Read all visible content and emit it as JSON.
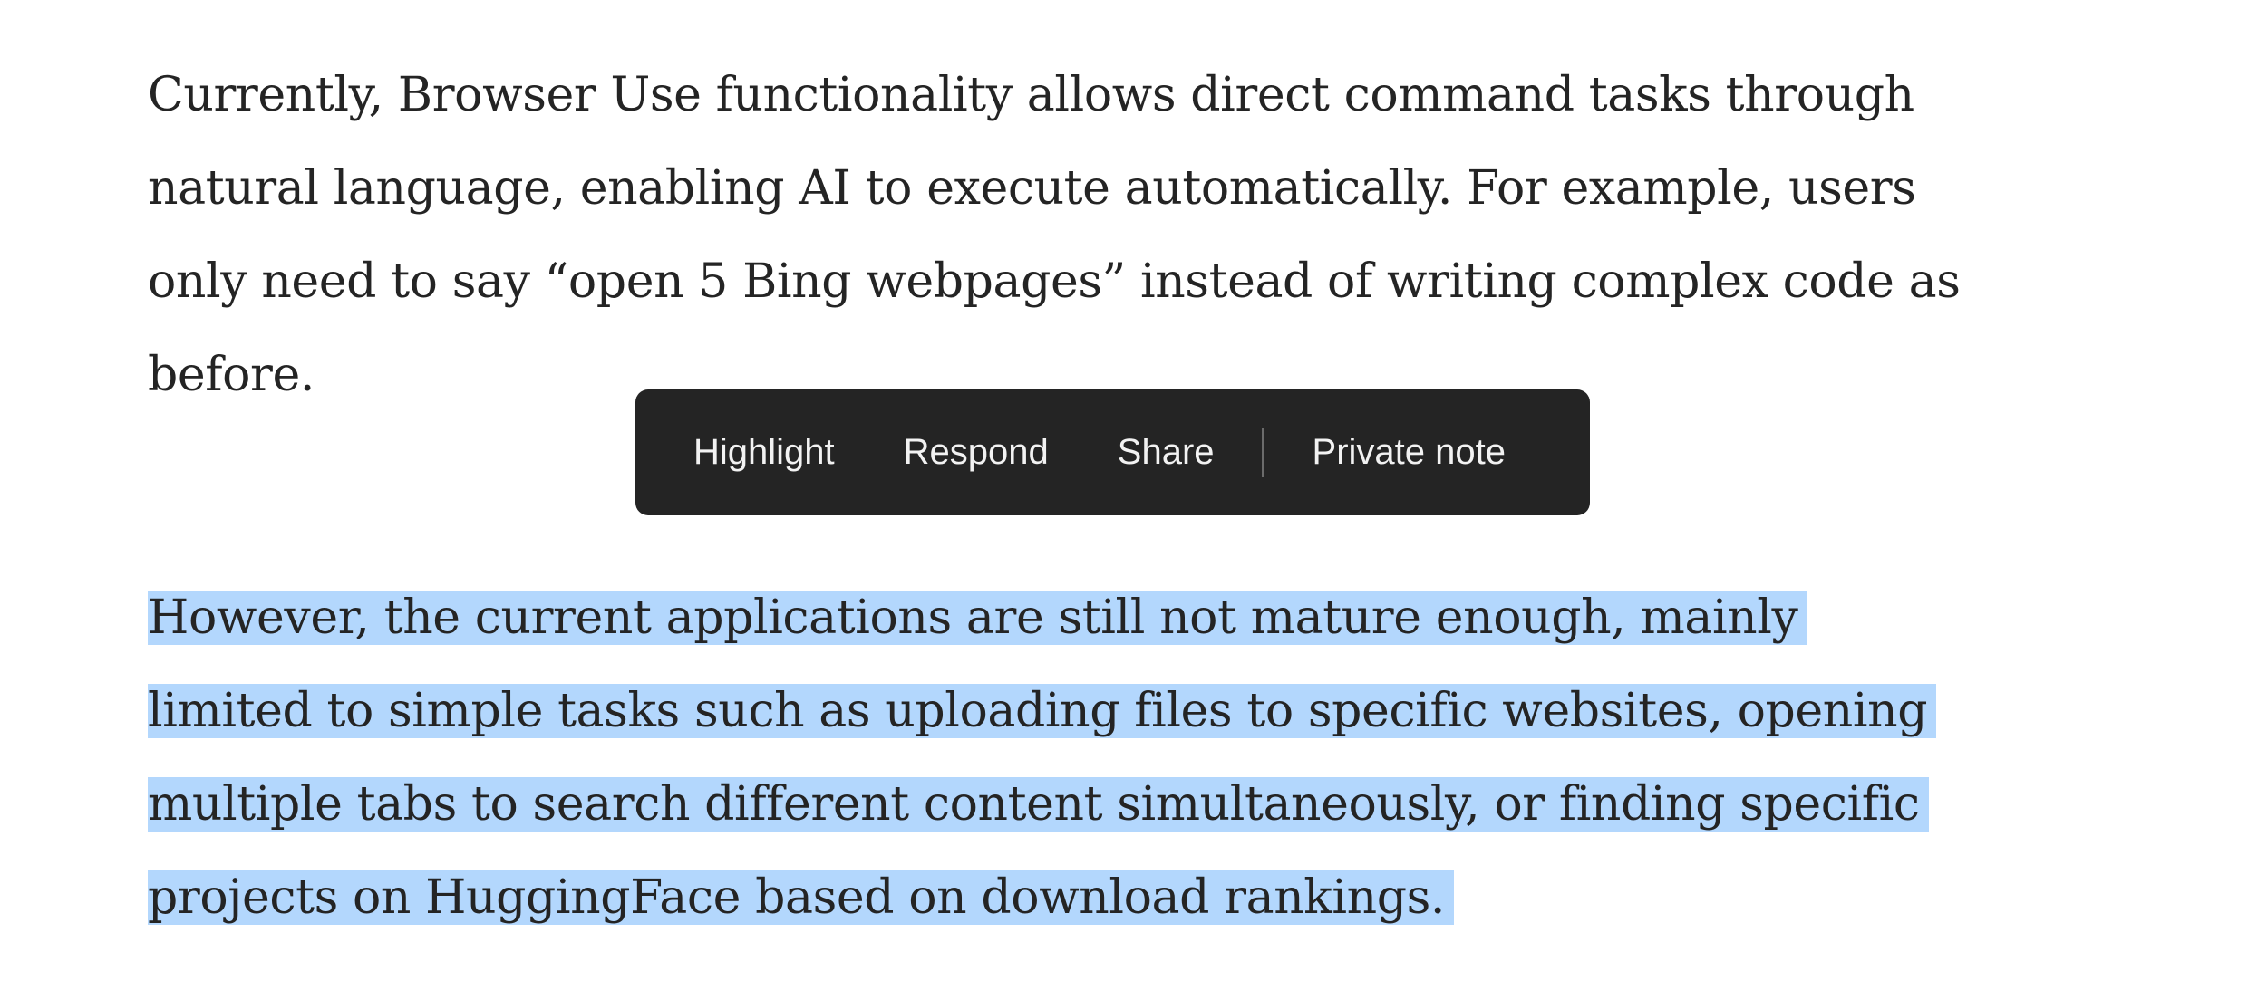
{
  "article": {
    "paragraph_1": {
      "lines": [
        "Currently, Browser Use functionality allows direct command tasks through",
        "natural language, enabling AI to execute automatically. For example, users",
        "only need to say “open 5 Bing webpages” instead of writing complex code as",
        "before."
      ]
    },
    "paragraph_2": {
      "selected": true,
      "lines": [
        "However, the current applications are still not mature enough, mainly",
        "limited to simple tasks such as uploading files to specific websites, opening",
        "multiple tabs to search different content simultaneously, or finding specific",
        "projects on HuggingFace based on download rankings."
      ]
    }
  },
  "selection_toolbar": {
    "highlight_label": "Highlight",
    "respond_label": "Respond",
    "share_label": "Share",
    "private_note_label": "Private note"
  },
  "colors": {
    "text": "#242424",
    "selection": "#b3d7fd",
    "toolbar_bg": "#242424",
    "toolbar_text": "#f2f2f2"
  }
}
